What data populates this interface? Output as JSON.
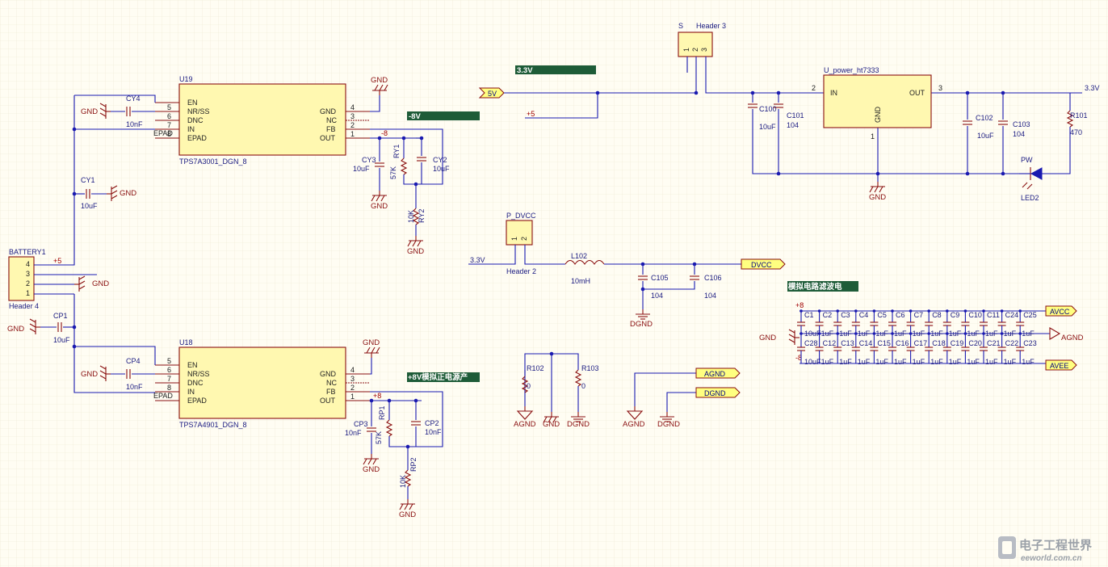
{
  "u19": {
    "ref": "U19",
    "part": "TPS7A3001_DGN_8",
    "pins_left": [
      "EN",
      "NR/SS",
      "DNC",
      "IN",
      "EPAD"
    ],
    "pins_right": [
      "GND",
      "NC",
      "FB",
      "OUT"
    ],
    "nums_left": [
      "5",
      "6",
      "7",
      "8"
    ],
    "nums_right": [
      "4",
      "3",
      "2",
      "1"
    ],
    "epad": "EPAD"
  },
  "u18": {
    "ref": "U18",
    "part": "TPS7A4901_DGN_8",
    "pins_left": [
      "EN",
      "NR/SS",
      "DNC",
      "IN",
      "EPAD"
    ],
    "pins_right": [
      "GND",
      "NC",
      "FB",
      "OUT"
    ],
    "nums_left": [
      "5",
      "6",
      "7",
      "8"
    ],
    "nums_right": [
      "4",
      "3",
      "2",
      "1"
    ],
    "epad": "EPAD"
  },
  "battery": {
    "ref": "BATTERY1",
    "part": "Header 4",
    "pins": [
      "4",
      "3",
      "2",
      "1"
    ],
    "plus5": "+5"
  },
  "cap_top": {
    "ref": "CY4",
    "val": "10nF"
  },
  "cap_cy1": {
    "ref": "CY1",
    "val": "10uF"
  },
  "cap_cp1": {
    "ref": "CP1",
    "val": "10uF"
  },
  "cap_bot": {
    "ref": "CP4",
    "val": "10nF"
  },
  "cy3": {
    "ref": "CY3",
    "val": "10uF"
  },
  "ry1": {
    "ref": "RY1",
    "val": "57K"
  },
  "cy2": {
    "ref": "CY2",
    "val": "10uF"
  },
  "ry2": {
    "ref": "RY2",
    "val": "10K"
  },
  "cp3": {
    "ref": "CP3",
    "val": "10nF"
  },
  "rp1": {
    "ref": "RP1",
    "val": "57K"
  },
  "cp2": {
    "ref": "CP2",
    "val": "10nF"
  },
  "rp2": {
    "ref": "RP2",
    "val": "10K"
  },
  "neg8": "-8",
  "pos8": "+8",
  "net_label_neg8v": "-8V",
  "net_label_pos8v": "+8V模拟正电源产",
  "net_label_3v3": "3.3V",
  "gnd": "GND",
  "agnd": "AGND",
  "dgnd": "DGND",
  "header3": {
    "ref": "S",
    "part": "Header 3",
    "pins": [
      "1",
      "2",
      "3"
    ]
  },
  "port_5v": "5V",
  "plus5": "+5",
  "reg": {
    "ref": "U_power_ht7333",
    "in": "IN",
    "out": "OUT",
    "gnd": "GND",
    "pin_in": "2",
    "pin_out": "3",
    "pin_gnd": "1"
  },
  "c100": {
    "ref": "C100",
    "val": "10uF"
  },
  "c101": {
    "ref": "C101",
    "val": "104"
  },
  "c102": {
    "ref": "C102",
    "val": "10uF"
  },
  "c103": {
    "ref": "C103",
    "val": "104"
  },
  "r101": {
    "ref": "R101",
    "val": "470"
  },
  "led": {
    "ref": "LED2",
    "label": "PW"
  },
  "out_3v3": "3.3V",
  "pdvcc": {
    "ref": "P_DVCC",
    "part": "Header 2",
    "pins": [
      "1",
      "2"
    ],
    "in_net": "3.3V"
  },
  "l102": {
    "ref": "L102",
    "val": "10mH"
  },
  "c105": {
    "ref": "C105",
    "val": "104"
  },
  "c106": {
    "ref": "C106",
    "val": "104"
  },
  "port_dvcc": "DVCC",
  "filter_title": "模拟电路滤波电",
  "filter_top_caps": [
    "C1",
    "C2",
    "C3",
    "C4",
    "C5",
    "C6",
    "C7",
    "C8",
    "C9",
    "C10",
    "C11",
    "C24",
    "C25"
  ],
  "filter_bot_caps": [
    "C28",
    "C12",
    "C13",
    "C14",
    "C15",
    "C16",
    "C17",
    "C18",
    "C19",
    "C20",
    "C21",
    "C22",
    "C23"
  ],
  "filter_val_first": "10uF",
  "filter_val": "1uF",
  "port_avcc": "AVCC",
  "port_agnd": "AGND",
  "port_avee": "AVEE",
  "r102": {
    "ref": "R102",
    "val": "0"
  },
  "r103": {
    "ref": "R103",
    "val": "0"
  },
  "port_agnd2": "AGND",
  "port_dgnd2": "DGND",
  "watermark": {
    "cn": "电子工程世界",
    "url": "eeworld.com.cn"
  }
}
